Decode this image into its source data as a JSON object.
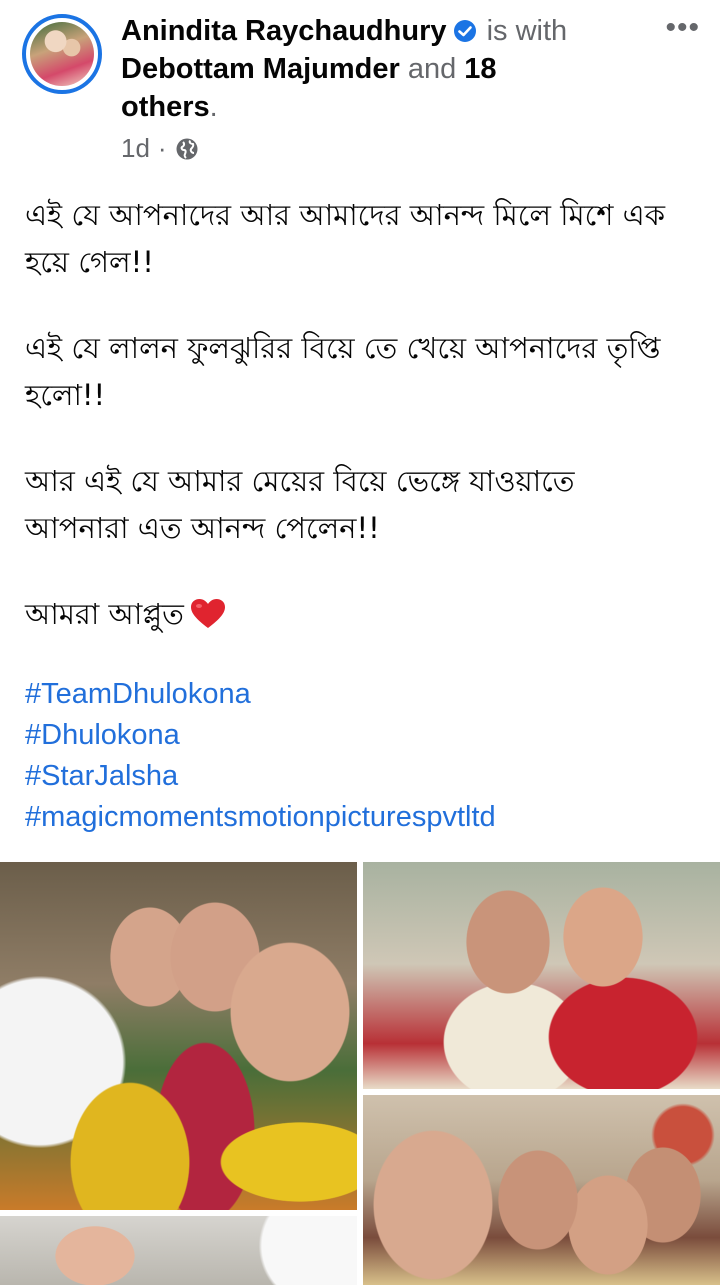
{
  "post": {
    "author": "Anindita Raychaudhury",
    "with_label": "is with",
    "tagged_name": "Debottam Majumder",
    "and_label": "and",
    "others_label": "18 others",
    "period": ".",
    "timestamp": "1d",
    "separator": "·",
    "privacy_icon": "globe-icon",
    "more_icon": "•••",
    "paragraphs": [
      "এই যে আপনাদের আর আমাদের আনন্দ মিলে মিশে এক হয়ে গেল!!",
      "এই যে লালন ফুলঝুরির বিয়ে তে খেয়ে আপনাদের তৃপ্তি হলো!!",
      "আর এই যে আমার মেয়ের বিয়ে ভেঙ্গে যাওয়াতে আপনারা এত আনন্দ পেলেন!!",
      "আমরা আপ্লুত"
    ],
    "hashtags": [
      "#TeamDhulokona",
      "#Dhulokona",
      "#StarJalsha",
      "#magicmomentsmotionpicturespvtltd"
    ],
    "colors": {
      "verified": "#1b74e4",
      "hashtag": "#216fdb",
      "secondary_text": "#65676b",
      "heart": "#e0242f"
    }
  }
}
